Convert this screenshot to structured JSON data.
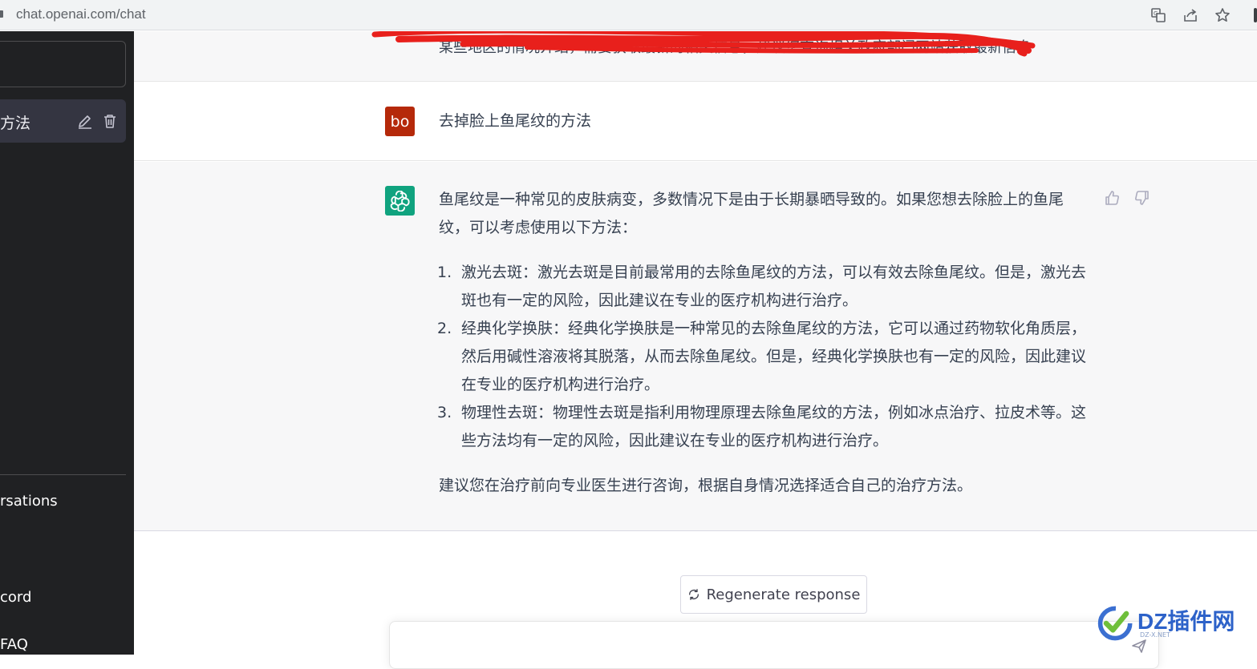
{
  "browser": {
    "url": "chat.openai.com/chat",
    "icons": [
      "translate-icon",
      "share-icon",
      "star-icon"
    ]
  },
  "sidebar": {
    "conversation_title": "方法",
    "links": [
      "rsations",
      "cord",
      "FAQ"
    ]
  },
  "chat": {
    "previous_message": "某些地区的情况介绍，需要获取最新的相关信息，建议您查询相关政府部门网站获取最新信息",
    "user": {
      "avatar_text": "bo",
      "avatar_color": "#b5290a",
      "message": "去掉脸上鱼尾纹的方法"
    },
    "assistant": {
      "avatar_color": "#10a37f",
      "intro": "鱼尾纹是一种常见的皮肤病变，多数情况下是由于长期暴晒导致的。如果您想去除脸上的鱼尾纹，可以考虑使用以下方法：",
      "items": [
        {
          "num": "1.",
          "text": "激光去斑：激光去斑是目前最常用的去除鱼尾纹的方法，可以有效去除鱼尾纹。但是，激光去斑也有一定的风险，因此建议在专业的医疗机构进行治疗。"
        },
        {
          "num": "2.",
          "text": "经典化学换肤：经典化学换肤是一种常见的去除鱼尾纹的方法，它可以通过药物软化角质层，然后用碱性溶液将其脱落，从而去除鱼尾纹。但是，经典化学换肤也有一定的风险，因此建议在专业的医疗机构进行治疗。"
        },
        {
          "num": "3.",
          "text": "物理性去斑：物理性去斑是指利用物理原理去除鱼尾纹的方法，例如冰点治疗、拉皮术等。这些方法均有一定的风险，因此建议在专业的医疗机构进行治疗。"
        }
      ],
      "conclusion": "建议您在治疗前向专业医生进行咨询，根据自身情况选择适合自己的治疗方法。"
    }
  },
  "controls": {
    "regenerate_label": "Regenerate response"
  },
  "watermark": {
    "text": "DZ插件网",
    "sub": "DZ-X.NET"
  }
}
